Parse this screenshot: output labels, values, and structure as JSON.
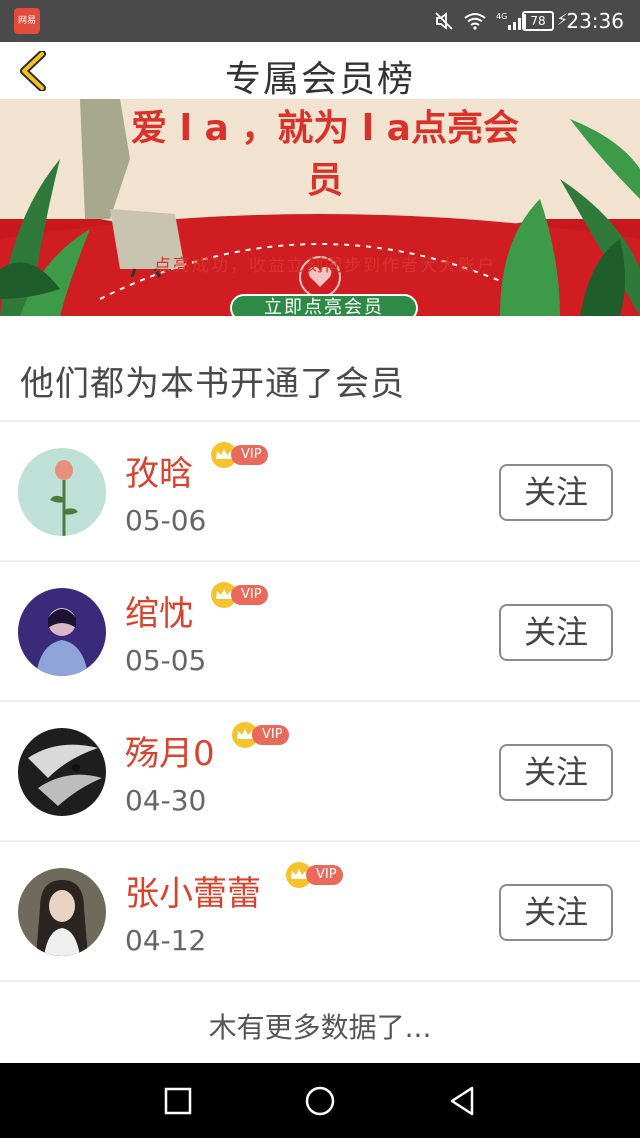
{
  "status_bar": {
    "app_icon_text": "网易",
    "battery": "78",
    "time": "23:36",
    "network": "4G"
  },
  "header": {
    "title": "专属会员榜"
  },
  "banner": {
    "headline": "爱 l a ，就为 l a点亮会员",
    "subtitle": "点亮成功，收益立刻同步到作者大大账户",
    "button_label": "立即点亮会员"
  },
  "section": {
    "heading": "他们都为本书开通了会员"
  },
  "members": [
    {
      "name": "孜晗",
      "vip": "VIP",
      "date": "05-06",
      "follow_label": "关注"
    },
    {
      "name": "绾忱",
      "vip": "VIP",
      "date": "05-05",
      "follow_label": "关注"
    },
    {
      "name": "殇月0",
      "vip": "VIP",
      "date": "04-30",
      "follow_label": "关注"
    },
    {
      "name": "张小蕾蕾",
      "vip": "VIP",
      "date": "04-12",
      "follow_label": "关注"
    }
  ],
  "footer": {
    "no_more_text": "木有更多数据了..."
  },
  "colors": {
    "accent": "#d9432e",
    "vip": "#e96a5b",
    "crown": "#f5c42c",
    "banner_green": "#2e8b45"
  }
}
